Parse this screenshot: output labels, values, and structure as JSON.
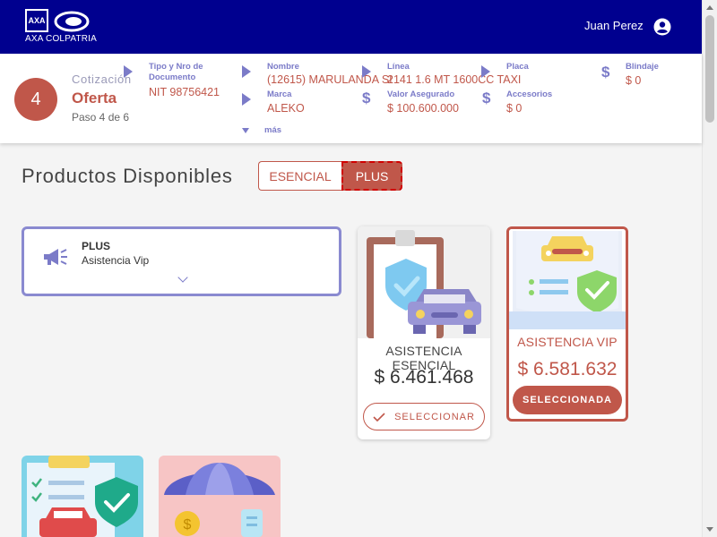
{
  "header": {
    "brand": "AXA COLPATRIA",
    "brand_mark": "AXA",
    "user_name": "Juan Perez"
  },
  "quote": {
    "step_number": "4",
    "label": "Cotización",
    "title": "Oferta",
    "step_text": "Paso 4 de 6"
  },
  "fields": {
    "tipo_doc_label": "Tipo y Nro de Documento",
    "tipo_doc_value": "NIT 98756421",
    "nombre_label": "Nombre",
    "nombre_value": "(12615) MARULANDA SI",
    "marca_label": "Marca",
    "marca_value": "ALEKO",
    "linea_label": "Línea",
    "linea_value": "2141 1.6 MT 1600CC TAXI",
    "valor_label": "Valor Asegurado",
    "valor_value": "$ 100.600.000",
    "placa_label": "Placa",
    "placa_value": "",
    "accesorios_label": "Accesorios",
    "accesorios_value": "$ 0",
    "blindaje_label": "Blindaje",
    "blindaje_value": "$ 0",
    "more_label": "más"
  },
  "products": {
    "title": "Productos Disponibles",
    "tabs": [
      "ESENCIAL",
      "PLUS"
    ],
    "active_tab": "PLUS",
    "plus_panel": {
      "label": "PLUS",
      "subtitle": "Asistencia Vip"
    },
    "cards": [
      {
        "name": "ASISTENCIA ESENCIAL",
        "price": "$ 6.461.468",
        "button": "SELECCIONAR",
        "selected": false
      },
      {
        "name": "ASISTENCIA VIP",
        "price": "$ 6.581.632",
        "button": "SELECCIONADA",
        "selected": true
      }
    ]
  },
  "colors": {
    "brand_blue": "#00008f",
    "accent": "#c0574a",
    "label_purple": "#7b7bc8"
  },
  "icons": [
    "user-icon",
    "chevron-right-icon",
    "dollar-icon",
    "chevron-down-icon",
    "megaphone-icon",
    "check-icon"
  ]
}
